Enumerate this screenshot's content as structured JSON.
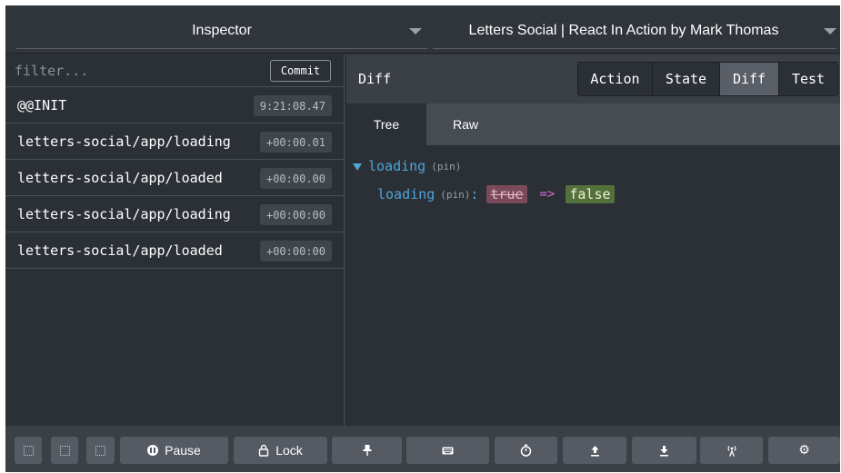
{
  "top_bar": {
    "left_dropdown": "Inspector",
    "right_dropdown": "Letters Social | React In Action by Mark Thomas"
  },
  "filter": {
    "placeholder": "filter...",
    "commit_label": "Commit"
  },
  "actions": [
    {
      "name": "@@INIT",
      "time": "9:21:08.47"
    },
    {
      "name": "letters-social/app/loading",
      "time": "+00:00.01"
    },
    {
      "name": "letters-social/app/loaded",
      "time": "+00:00.00"
    },
    {
      "name": "letters-social/app/loading",
      "time": "+00:00:00"
    },
    {
      "name": "letters-social/app/loaded",
      "time": "+00:00:00"
    }
  ],
  "monitor": {
    "title": "Diff",
    "tabs": [
      "Action",
      "State",
      "Diff",
      "Test"
    ],
    "active_tab": "Diff",
    "subtabs": [
      "Tree",
      "Raw"
    ],
    "active_subtab": "Tree"
  },
  "diff_tree": {
    "root_key": "loading",
    "root_tag": "(pin)",
    "child_key": "loading",
    "child_tag": "(pin)",
    "colon": ":",
    "old_value": "true",
    "arrow": "=>",
    "new_value": "false"
  },
  "bottom_bar": {
    "pause_label": "Pause",
    "lock_label": "Lock",
    "icons": [
      "pin-icon",
      "keyboard-icon",
      "stopwatch-icon",
      "upload-icon",
      "download-icon",
      "remote-icon",
      "settings-icon"
    ]
  },
  "colors": {
    "background": "#2b2f36",
    "key_blue": "#4fa5d6",
    "removed_bg": "#7b4a5a",
    "added_bg": "#55713b",
    "arrow_pink": "#d36bd0"
  }
}
